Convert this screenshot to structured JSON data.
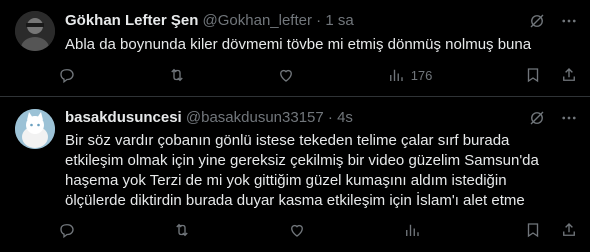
{
  "tweets": [
    {
      "name": "Gökhan Lefter Şen",
      "handle": "@Gokhan_lefter",
      "sep": "·",
      "time": "1 sa",
      "text": "Abla da boynunda kiler dövmemi tövbe mi etmiş dönmüş nolmuş buna",
      "views": "176",
      "avatar_icon": "profile-photo-man",
      "avatar_color": "#3a3a3a"
    },
    {
      "name": "basakdusuncesi",
      "handle": "@basakdusun33157",
      "sep": "·",
      "time": "4s",
      "text": "Bir söz vardır çobanın gönlü istese tekeden telime çalar sırf burada etkileşim olmak için yine gereksiz çekilmiş bir video güzelim Samsun'da haşema yok Terzi de mi yok gittiğim güzel kumaşını aldım istediğin ölçülerde diktirdin burada duyar kasma etkileşim için İslam'ı alet etme",
      "views": "",
      "avatar_icon": "profile-photo-cat",
      "avatar_color": "#8fb6c8"
    }
  ],
  "icons": {
    "grok": "grok-icon",
    "more": "more-icon",
    "reply": "reply-icon",
    "retweet": "retweet-icon",
    "like": "like-icon",
    "views": "views-icon",
    "bookmark": "bookmark-icon",
    "share": "share-icon"
  },
  "colors": {
    "background": "#000000",
    "text": "#e7e9ea",
    "secondary": "#71767b",
    "divider": "#2f3336"
  }
}
